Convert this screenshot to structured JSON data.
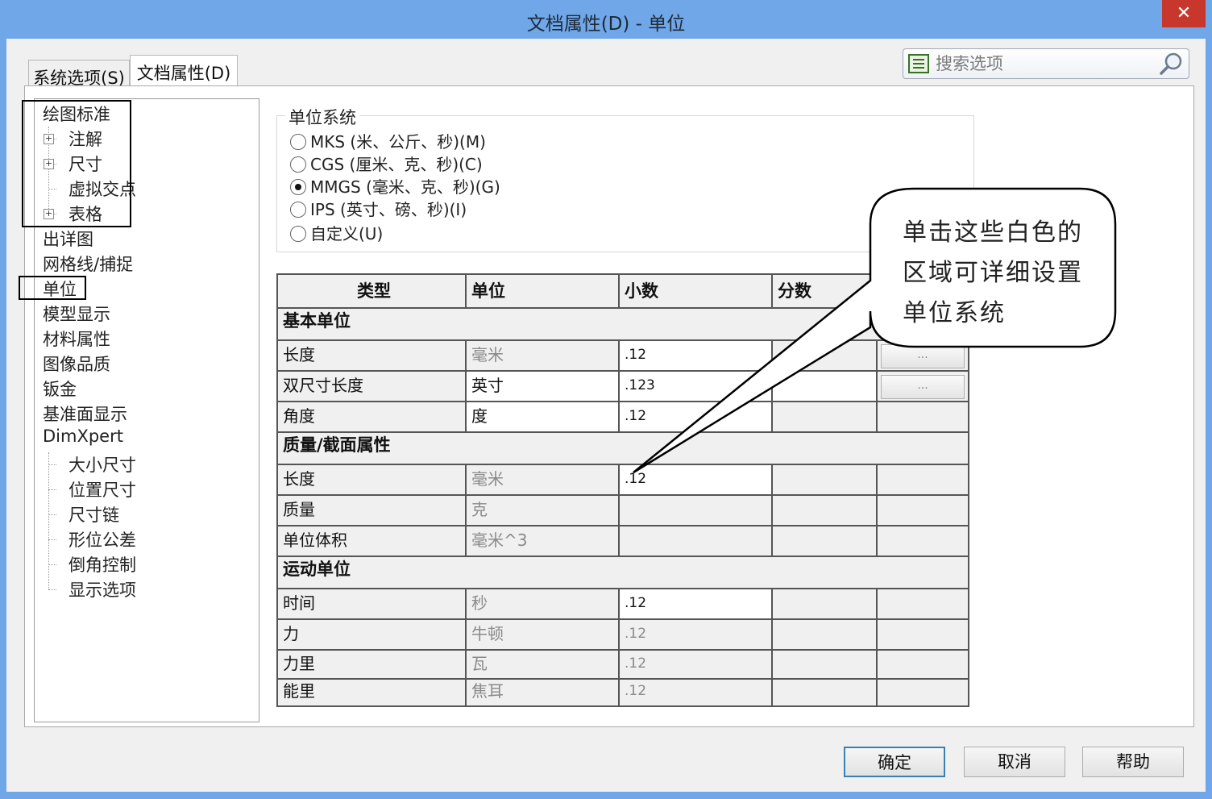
{
  "window": {
    "title": "文档属性(D) - 单位",
    "close_glyph": "✕"
  },
  "tabs": [
    {
      "label": "系统选项(S)"
    },
    {
      "label": "文档属性(D)"
    }
  ],
  "search": {
    "placeholder": "搜索选项"
  },
  "tree": {
    "items": [
      {
        "label": "绘图标准"
      },
      {
        "label": "注解"
      },
      {
        "label": "尺寸"
      },
      {
        "label": "虚拟交点"
      },
      {
        "label": "表格"
      },
      {
        "label": "出详图"
      },
      {
        "label": "网格线/捕捉"
      },
      {
        "label": "单位"
      },
      {
        "label": "模型显示"
      },
      {
        "label": "材料属性"
      },
      {
        "label": "图像品质"
      },
      {
        "label": "钣金"
      },
      {
        "label": "基准面显示"
      },
      {
        "label": "DimXpert"
      },
      {
        "label": "大小尺寸"
      },
      {
        "label": "位置尺寸"
      },
      {
        "label": "尺寸链"
      },
      {
        "label": "形位公差"
      },
      {
        "label": "倒角控制"
      },
      {
        "label": "显示选项"
      }
    ]
  },
  "unit_system": {
    "legend": "单位系统",
    "options": [
      {
        "label": "MKS (米、公斤、秒)(M)"
      },
      {
        "label": "CGS (厘米、克、秒)(C)"
      },
      {
        "label": "MMGS (毫米、克、秒)(G)"
      },
      {
        "label": "IPS (英寸、磅、秒)(I)"
      },
      {
        "label": "自定义(U)"
      }
    ],
    "selected": "MMGS (毫米、克、秒)(G)"
  },
  "table": {
    "headers": {
      "type": "类型",
      "unit": "单位",
      "decimals": "小数",
      "fractions": "分数"
    },
    "sections": {
      "basic": "基本单位",
      "mass": "质量/截面属性",
      "motion": "运动单位"
    },
    "rows": {
      "length": {
        "type": "长度",
        "unit": "毫米",
        "decimals": ".12",
        "more": "..."
      },
      "dual": {
        "type": "双尺寸长度",
        "unit": "英寸",
        "decimals": ".123",
        "more": "..."
      },
      "angle": {
        "type": "角度",
        "unit": "度",
        "decimals": ".12"
      },
      "mass_length": {
        "type": "长度",
        "unit": "毫米",
        "decimals": ".12"
      },
      "mass": {
        "type": "质量",
        "unit": "克"
      },
      "volume": {
        "type": "单位体积",
        "unit": "毫米^3"
      },
      "time": {
        "type": "时间",
        "unit": "秒",
        "decimals": ".12"
      },
      "force": {
        "type": "力",
        "unit": "牛顿",
        "decimals": ".12"
      },
      "power": {
        "type": "力里",
        "unit": "瓦",
        "decimals": ".12"
      },
      "energy": {
        "type": "能里",
        "unit": "焦耳",
        "decimals": ".12"
      }
    }
  },
  "callout": {
    "line1": "单击这些白色的",
    "line2": "区域可详细设置",
    "line3": "单位系统"
  },
  "buttons": {
    "ok": "确定",
    "cancel": "取消",
    "help": "帮助"
  }
}
